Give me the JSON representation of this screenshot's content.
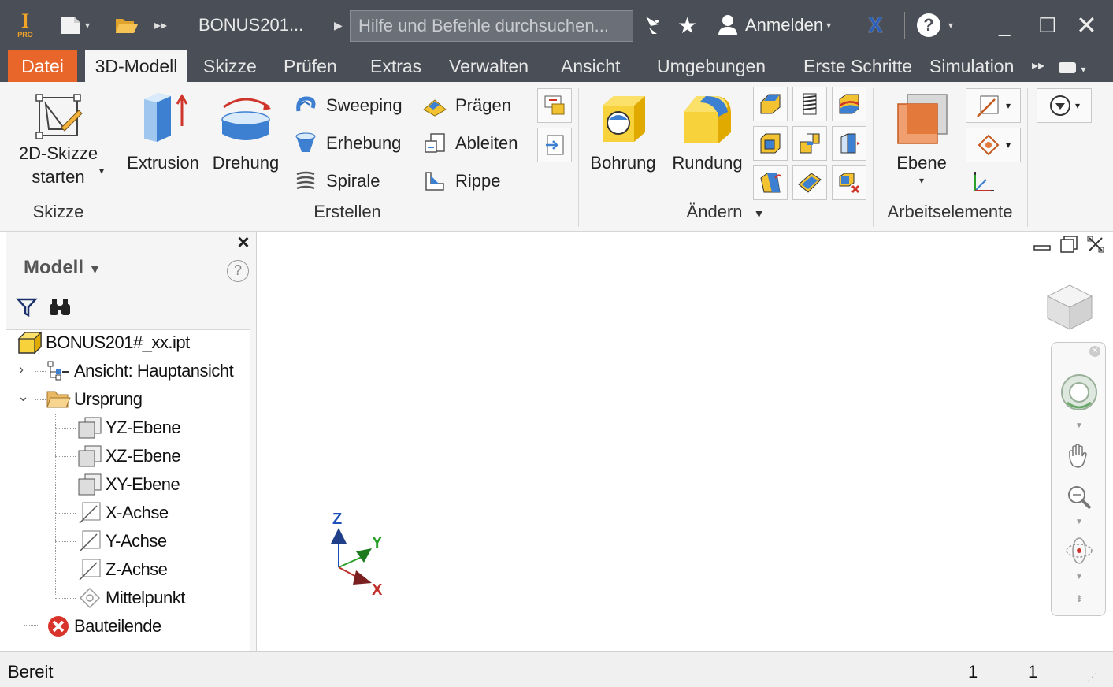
{
  "titlebar": {
    "logo_text": "I",
    "logo_sub": "PRO",
    "document_title": "BONUS201...",
    "search_placeholder": "Hilfe und Befehle durchsuchen...",
    "signin_label": "Anmelden",
    "icons": [
      "new-icon",
      "open-icon",
      "more-icon",
      "play-icon",
      "satellite-icon",
      "star-icon",
      "user-icon",
      "exchange-icon",
      "help-icon",
      "minimize-icon",
      "maximize-icon",
      "close-icon"
    ]
  },
  "ribbon_tabs": [
    {
      "label": "Datei"
    },
    {
      "label": "3D-Modell"
    },
    {
      "label": "Skizze"
    },
    {
      "label": "Prüfen"
    },
    {
      "label": "Extras"
    },
    {
      "label": "Verwalten"
    },
    {
      "label": "Ansicht"
    },
    {
      "label": "Umgebungen"
    },
    {
      "label": "Erste Schritte"
    },
    {
      "label": "Simulation"
    }
  ],
  "ribbon": {
    "sketch_group": {
      "start_sketch_line1": "2D-Skizze",
      "start_sketch_line2": "starten",
      "label": "Skizze"
    },
    "create_group": {
      "extrusion": "Extrusion",
      "revolve": "Drehung",
      "sweep": "Sweeping",
      "loft": "Erhebung",
      "coil": "Spirale",
      "emboss": "Prägen",
      "derive": "Ableiten",
      "rib": "Rippe",
      "label": "Erstellen"
    },
    "modify_group": {
      "hole": "Bohrung",
      "fillet": "Rundung",
      "label": "Ändern"
    },
    "work_features_group": {
      "plane": "Ebene",
      "label": "Arbeitselemente"
    }
  },
  "browser": {
    "title": "Modell",
    "help": "?",
    "close": "×",
    "tree": {
      "root": "BONUS201#_xx.ipt",
      "view": "Ansicht: Hauptansicht",
      "origin": "Ursprung",
      "yz": "YZ-Ebene",
      "xz": "XZ-Ebene",
      "xy": "XY-Ebene",
      "x_axis": "X-Achse",
      "y_axis": "Y-Achse",
      "z_axis": "Z-Achse",
      "center": "Mittelpunkt",
      "end_of_part": "Bauteilende"
    }
  },
  "viewport": {
    "triad": {
      "x": "X",
      "y": "Y",
      "z": "Z"
    },
    "colors": {
      "x": "#c0302a",
      "y": "#2aa02a",
      "z": "#1f4fb8"
    }
  },
  "statusbar": {
    "status": "Bereit",
    "cell1": "1",
    "cell2": "1"
  },
  "colors": {
    "titlebar_bg": "#4a4e56",
    "file_tab": "#e8662a",
    "ribbon_bg": "#f5f5f5"
  }
}
